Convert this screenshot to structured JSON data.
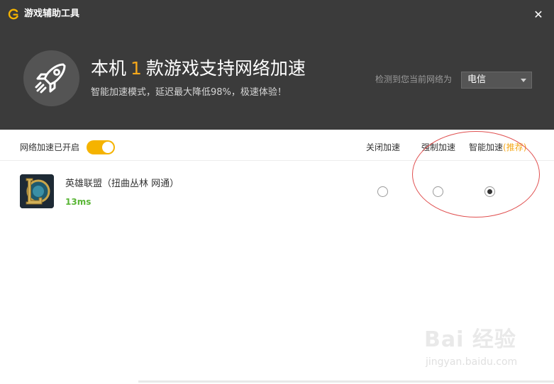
{
  "window": {
    "title": "游戏辅助工具",
    "close_glyph": "✕"
  },
  "header": {
    "headline_prefix": "本机",
    "game_count": "1",
    "headline_suffix": "款游戏支持网络加速",
    "subline": "智能加速模式，延迟最大降低98%，极速体验！",
    "detect_label": "检测到您当前网络为",
    "isp_selected": "电信",
    "icon": "rocket-icon"
  },
  "toolbar": {
    "toggle_label": "网络加速已开启",
    "toggle_on": true,
    "col_off": "关闭加速",
    "col_force": "强制加速",
    "col_smart": "智能加速",
    "col_smart_rec": "(推荐)"
  },
  "games": [
    {
      "name": "英雄联盟（扭曲丛林 网通）",
      "ping": "13ms",
      "icon": "league-of-legends-icon",
      "mode": "smart"
    }
  ],
  "watermark": {
    "logo": "Bai 经验",
    "url": "jingyan.baidu.com"
  },
  "colors": {
    "accent": "#f5a81b",
    "header_bg": "#3b3b3b",
    "ping_green": "#59b535",
    "annotation_red": "#e05050"
  }
}
